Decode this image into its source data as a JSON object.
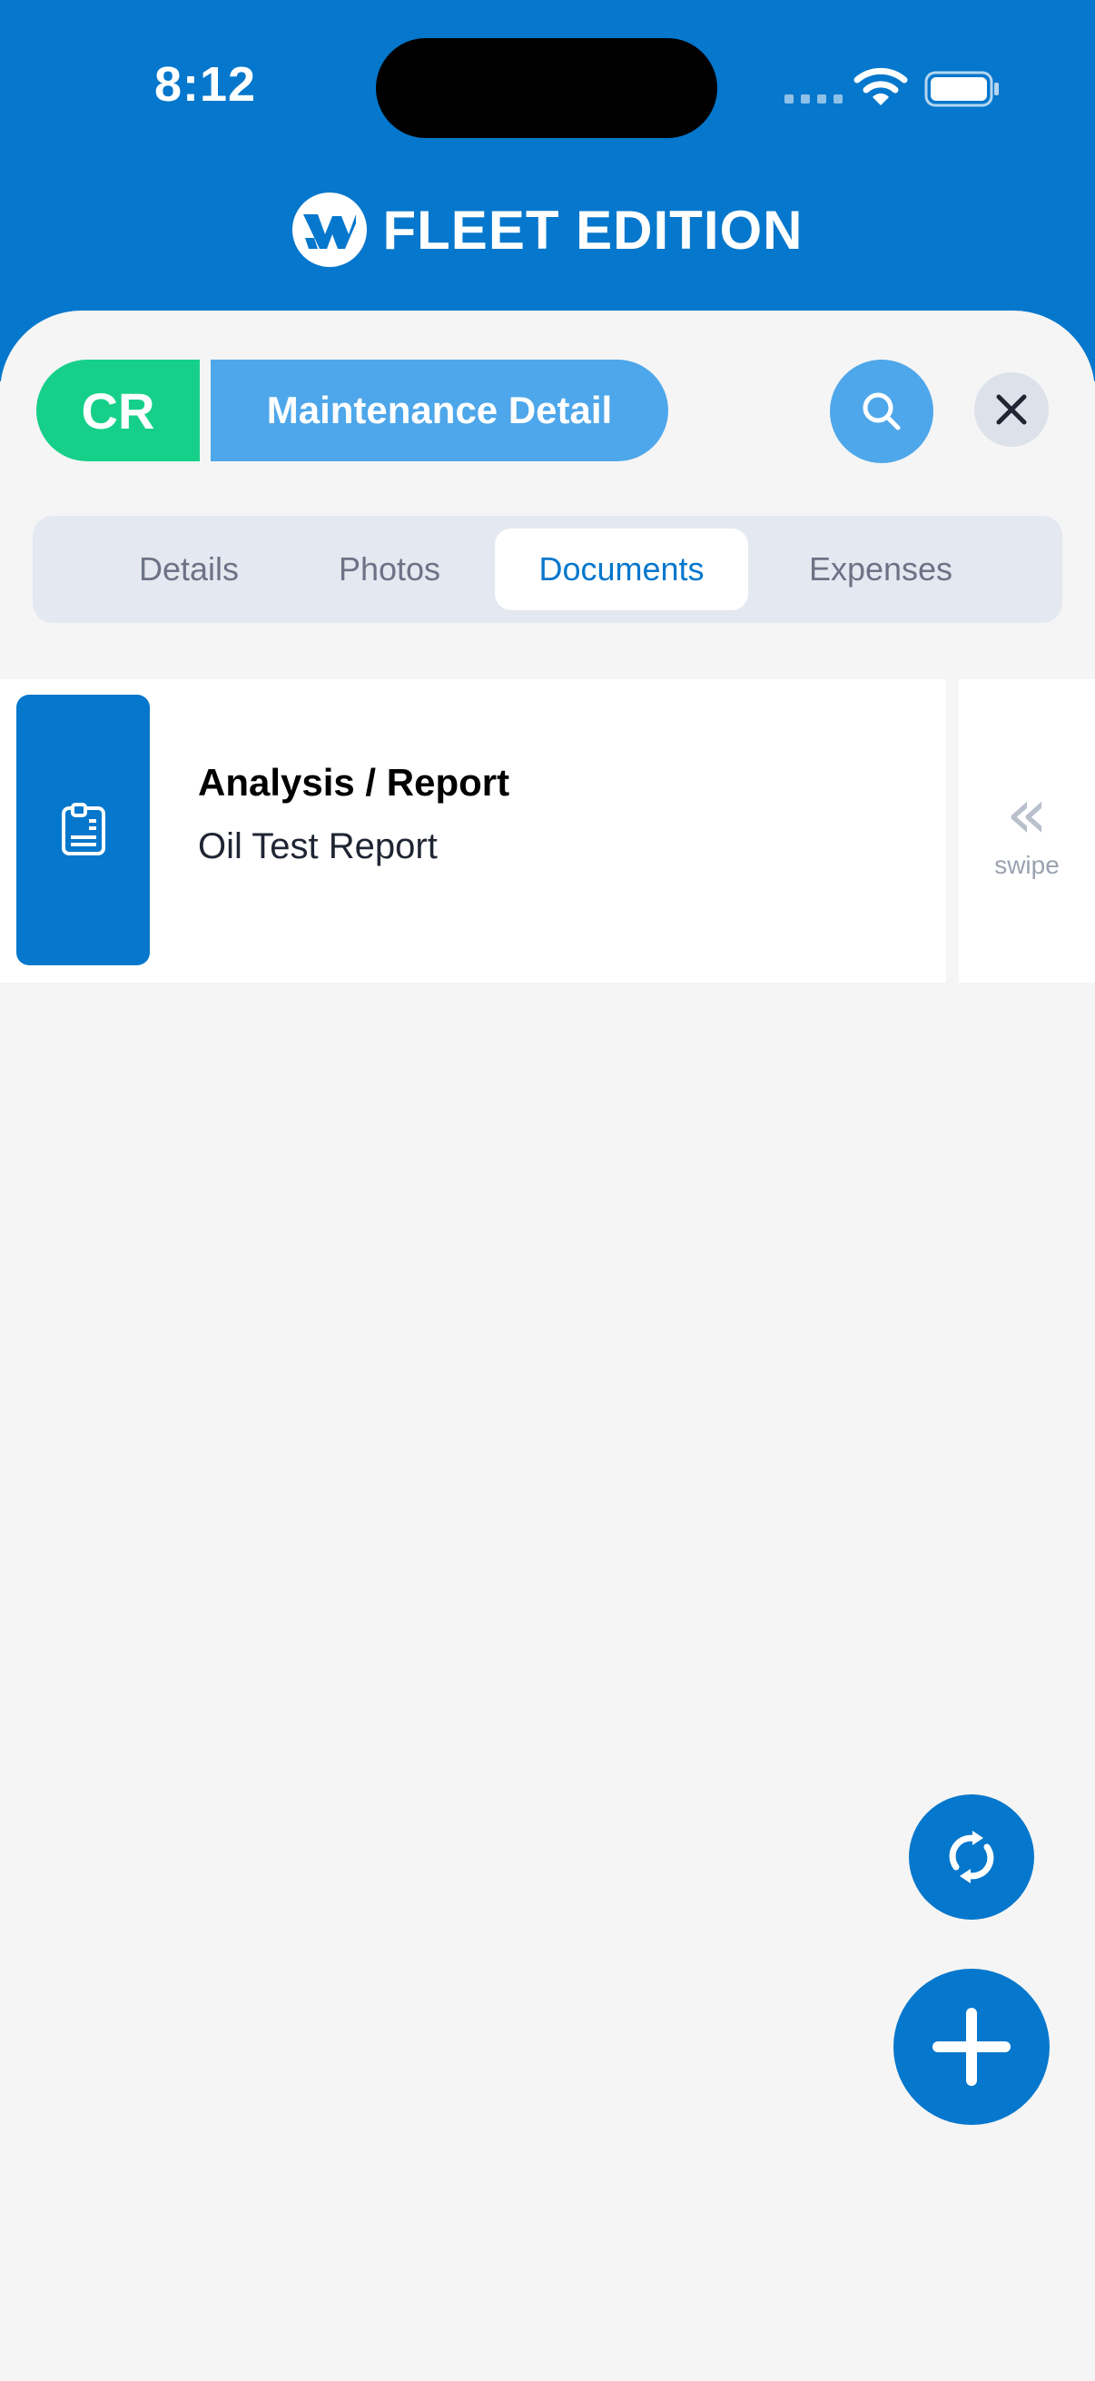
{
  "status_bar": {
    "time": "8:12"
  },
  "brand": {
    "name": "FLEET EDITION"
  },
  "header": {
    "badge": "CR",
    "title": "Maintenance Detail"
  },
  "tabs": [
    {
      "label": "Details",
      "active": false
    },
    {
      "label": "Photos",
      "active": false
    },
    {
      "label": "Documents",
      "active": true
    },
    {
      "label": "Expenses",
      "active": false
    }
  ],
  "documents": [
    {
      "category": "Analysis / Report",
      "name": "Oil Test Report",
      "icon": "clipboard-document-icon"
    }
  ],
  "swipe_hint": {
    "arrows": "«",
    "label": "swipe"
  },
  "icons": {
    "search": "search-icon",
    "close": "close-icon",
    "refresh": "refresh-icon",
    "add": "plus-icon"
  },
  "colors": {
    "primary": "#0577cc",
    "accent_light": "#4ea7ea",
    "badge_green": "#16d08a",
    "tab_bg": "#e4e8f0",
    "background": "#f5f5f5"
  }
}
